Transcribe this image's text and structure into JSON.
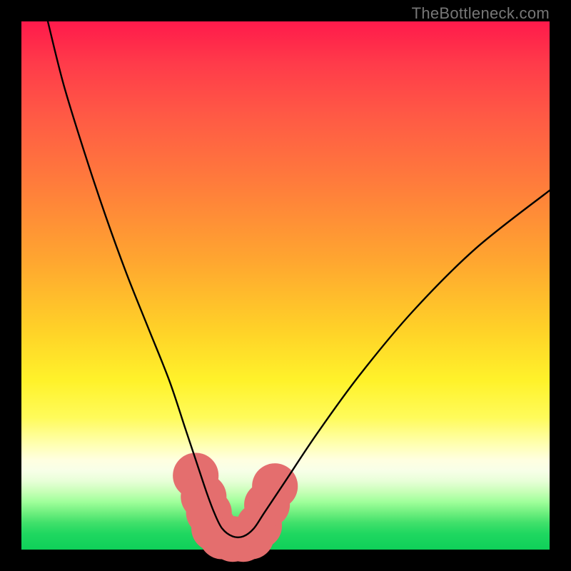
{
  "watermark": "TheBottleneck.com",
  "colors": {
    "background": "#000000",
    "gradient_top": "#ff1a4b",
    "gradient_mid": "#fff22a",
    "gradient_bottom": "#0fd059",
    "curve": "#000000",
    "bead": "#e46e6e"
  },
  "chart_data": {
    "type": "line",
    "title": "",
    "xlabel": "",
    "ylabel": "",
    "xlim": [
      0,
      100
    ],
    "ylim": [
      0,
      100
    ],
    "grid": false,
    "legend": false,
    "annotations": [],
    "series": [
      {
        "name": "bottleneck-curve",
        "x": [
          5,
          8,
          12,
          16,
          20,
          24,
          28,
          31,
          33,
          35,
          36.5,
          38,
          40,
          42,
          44,
          46,
          50,
          56,
          64,
          74,
          86,
          100
        ],
        "y": [
          100,
          88,
          75,
          63,
          52,
          42,
          32,
          23,
          17,
          11,
          7,
          4,
          2.5,
          2.5,
          4,
          7,
          13,
          22,
          33,
          45,
          57,
          68
        ]
      }
    ],
    "markers": [
      {
        "name": "bead",
        "x": 33.0,
        "y": 14,
        "r": 2.2
      },
      {
        "name": "bead",
        "x": 34.5,
        "y": 10,
        "r": 2.2
      },
      {
        "name": "bead",
        "x": 35.5,
        "y": 7,
        "r": 2.2
      },
      {
        "name": "bead",
        "x": 36.5,
        "y": 4,
        "r": 2.2
      },
      {
        "name": "bead",
        "x": 38.0,
        "y": 2.5,
        "r": 2.2
      },
      {
        "name": "bead",
        "x": 40.0,
        "y": 2.0,
        "r": 2.2
      },
      {
        "name": "bead",
        "x": 42.0,
        "y": 2.0,
        "r": 2.2
      },
      {
        "name": "bead",
        "x": 43.5,
        "y": 2.5,
        "r": 2.2
      },
      {
        "name": "bead",
        "x": 45.0,
        "y": 4.5,
        "r": 2.2
      },
      {
        "name": "bead",
        "x": 46.5,
        "y": 8.5,
        "r": 2.2
      },
      {
        "name": "bead",
        "x": 48.0,
        "y": 12,
        "r": 2.2
      }
    ]
  }
}
